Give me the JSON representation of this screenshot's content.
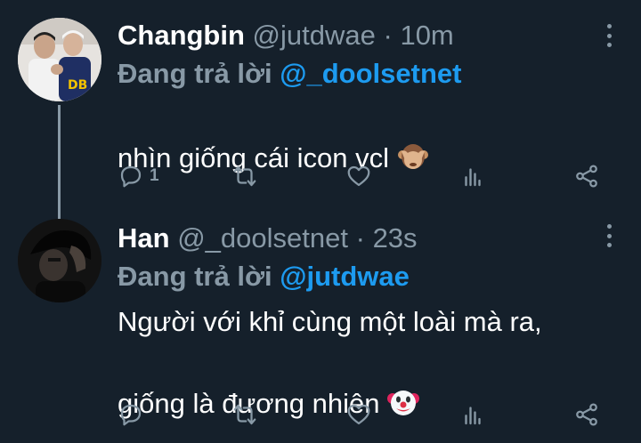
{
  "tweets": [
    {
      "name": "Changbin",
      "handle": "@jutdwae",
      "separator": "·",
      "time": "10m",
      "reply_label": "Đang trả lời",
      "reply_to": "@_doolsetnet",
      "text": "nhìn giống cái icon vcl",
      "emoji": "see-no-evil-monkey",
      "reply_count": "1"
    },
    {
      "name": "Han",
      "handle": "@_doolsetnet",
      "separator": "·",
      "time": "23s",
      "reply_label": "Đang trả lời",
      "reply_to": "@jutdwae",
      "text": "Người với khỉ cùng một loài mà ra,\ngiống là đương nhiên",
      "emoji": "clown-face",
      "reply_count": ""
    }
  ],
  "colors": {
    "background": "#15202b",
    "secondary_text": "#8899a6",
    "link": "#1d9bf0",
    "primary_text": "#ffffff"
  },
  "icons": [
    "reply-icon",
    "retweet-icon",
    "like-icon",
    "stats-icon",
    "share-icon",
    "more-icon"
  ]
}
